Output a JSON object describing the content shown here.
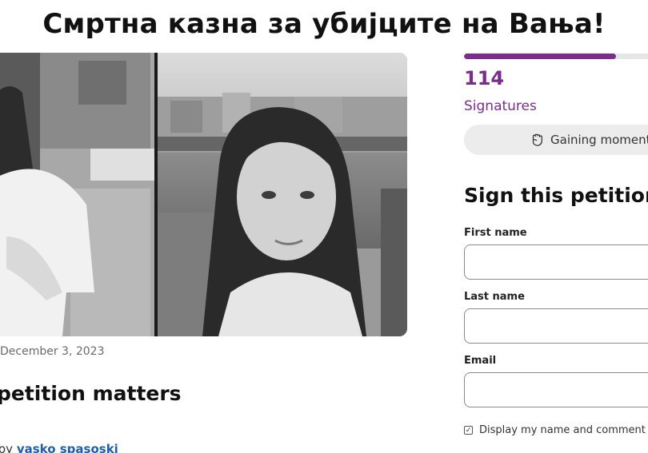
{
  "petition": {
    "title": "Смртна казна за убијците на Вања!",
    "date": "December 3, 2023",
    "section_heading": "petition matters",
    "author_prefix": "oy ",
    "author_name": "vasko spasoski"
  },
  "signatures": {
    "count": "114",
    "label": "Signatures",
    "progress": 0.79,
    "momentum_label": "Gaining momentum"
  },
  "sign_form": {
    "title": "Sign this petition",
    "first_name_label": "First name",
    "last_name_label": "Last name",
    "email_label": "Email",
    "display_label": "Display my name and comment on"
  },
  "colors": {
    "accent": "#7b2d8e",
    "link": "#1e5fa8"
  },
  "icons": {
    "momentum": "raised-fist-icon",
    "checkbox": "checkbox-checked-icon"
  }
}
